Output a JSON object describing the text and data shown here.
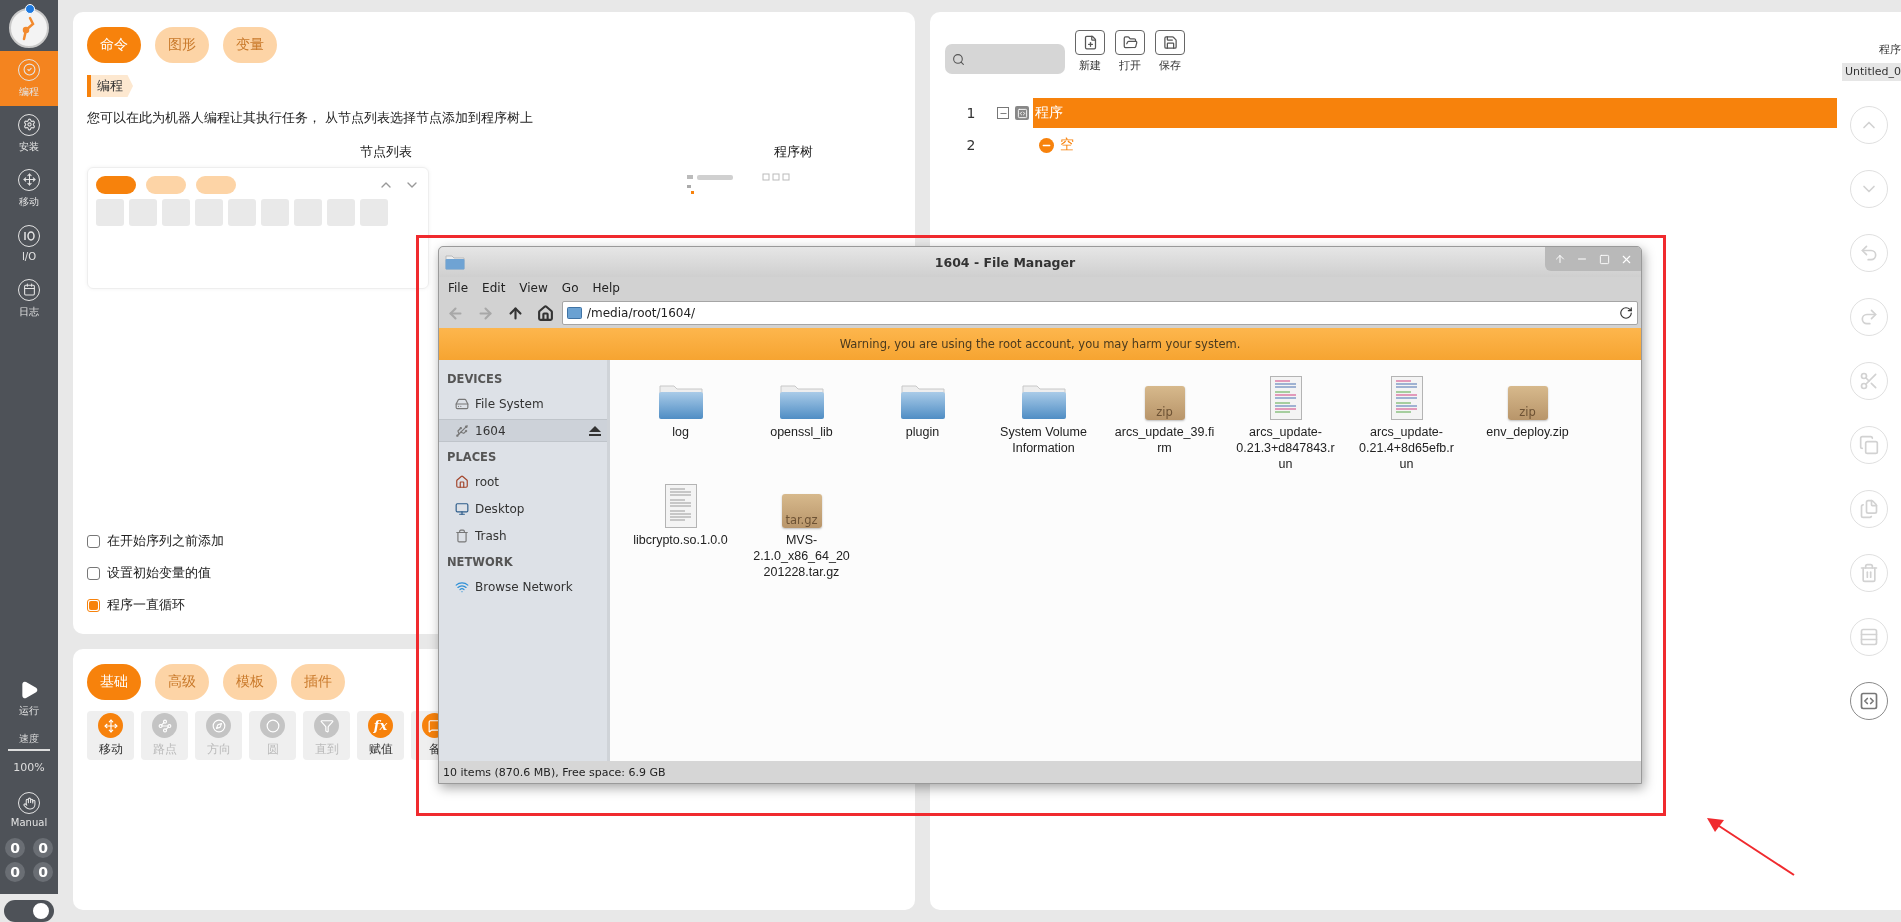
{
  "sidebar": {
    "items": [
      {
        "label": "编程",
        "selected": true
      },
      {
        "label": "安装",
        "selected": false
      },
      {
        "label": "移动",
        "selected": false
      },
      {
        "label": "I/O",
        "selected": false
      },
      {
        "label": "日志",
        "selected": false
      }
    ],
    "run": "运行",
    "speed_label": "速度",
    "speed": "100%",
    "mode": "Manual",
    "io_counters": [
      "0",
      "0",
      "0",
      "0"
    ],
    "toggle_on": true
  },
  "program_panel": {
    "tabs": [
      {
        "label": "命令",
        "selected": true
      },
      {
        "label": "图形",
        "selected": false
      },
      {
        "label": "变量",
        "selected": false
      }
    ],
    "section": "编程",
    "description": "您可以在此为机器人编程让其执行任务， 从节点列表选择节点添加到程序树上",
    "node_list_title": "节点列表",
    "tree_title": "程序树",
    "node_tabs": [
      {
        "selected": true
      },
      {
        "selected": false
      },
      {
        "selected": false
      }
    ],
    "options": [
      {
        "label": "在开始序列之前添加",
        "checked": false
      },
      {
        "label": "设置初始变量的值",
        "checked": false
      },
      {
        "label": "程序一直循环",
        "checked": true
      }
    ]
  },
  "node_panel": {
    "tabs": [
      {
        "label": "基础",
        "selected": true
      },
      {
        "label": "高级",
        "selected": false
      },
      {
        "label": "模板",
        "selected": false
      },
      {
        "label": "插件",
        "selected": false
      }
    ],
    "nodes": [
      {
        "label": "移动",
        "disabled": false
      },
      {
        "label": "路点",
        "disabled": true
      },
      {
        "label": "方向",
        "disabled": true
      },
      {
        "label": "圆",
        "disabled": true
      },
      {
        "label": "直到",
        "disabled": true
      },
      {
        "label": "赋值",
        "glyph": "fx",
        "disabled": false
      },
      {
        "label": "备",
        "disabled": false
      }
    ]
  },
  "tree_panel": {
    "actions": [
      "新建",
      "打开",
      "保存"
    ],
    "program_label": "程序",
    "file_name": "Untitled_0",
    "rows": [
      {
        "number": "1",
        "label": "程序",
        "kind": "program",
        "expanded": true,
        "selected": true
      },
      {
        "number": "2",
        "label": "空",
        "kind": "empty",
        "selected": false
      }
    ],
    "tools": [
      {
        "disabled": true
      },
      {
        "disabled": true
      },
      {
        "disabled": true
      },
      {
        "disabled": true
      },
      {
        "disabled": true
      },
      {
        "disabled": true
      },
      {
        "disabled": true
      },
      {
        "disabled": true
      },
      {
        "disabled": true
      },
      {
        "disabled": false
      }
    ]
  },
  "file_manager": {
    "title": "1604 - File Manager",
    "menu": [
      "File",
      "Edit",
      "View",
      "Go",
      "Help"
    ],
    "nav": [
      {
        "disabled": true
      },
      {
        "disabled": true
      },
      {
        "disabled": false
      },
      {
        "disabled": false
      }
    ],
    "path": "/media/root/1604/",
    "warning": "Warning, you are using the root account, you may harm your system.",
    "sidebar": [
      {
        "heading": "DEVICES",
        "items": [
          {
            "label": "File System",
            "selected": false,
            "eject": false
          },
          {
            "label": "1604",
            "selected": true,
            "eject": true
          }
        ]
      },
      {
        "heading": "PLACES",
        "items": [
          {
            "label": "root",
            "selected": false,
            "eject": false
          },
          {
            "label": "Desktop",
            "selected": false,
            "eject": false
          },
          {
            "label": "Trash",
            "selected": false,
            "eject": false
          }
        ]
      },
      {
        "heading": "NETWORK",
        "items": [
          {
            "label": "Browse Network",
            "selected": false,
            "eject": false
          }
        ]
      }
    ],
    "files": [
      {
        "name": "log",
        "kind": "folder"
      },
      {
        "name": "openssl_lib",
        "kind": "folder"
      },
      {
        "name": "plugin",
        "kind": "folder"
      },
      {
        "name": "System Volume Information",
        "kind": "folder"
      },
      {
        "name": "arcs_update_39.firm",
        "kind": "archive",
        "badge": "zip"
      },
      {
        "name": "arcs_update-0.21.3+d847843.run",
        "kind": "script"
      },
      {
        "name": "arcs_update-0.21.4+8d65efb.run",
        "kind": "script"
      },
      {
        "name": "env_deploy.zip",
        "kind": "archive",
        "badge": "zip"
      },
      {
        "name": "libcrypto.so.1.0.0",
        "kind": "document"
      },
      {
        "name": "MVS-2.1.0_x86_64_20201228.tar.gz",
        "kind": "archive",
        "badge": "tar.gz"
      }
    ],
    "status": "10 items (870.6 MB), Free space: 6.9 GB"
  }
}
